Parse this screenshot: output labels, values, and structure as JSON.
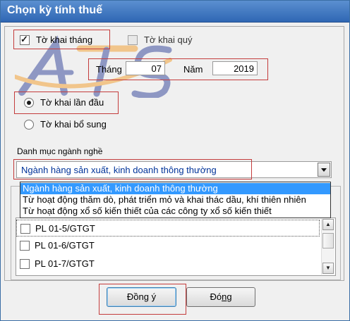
{
  "window": {
    "title": "Chọn kỳ tính thuế"
  },
  "period": {
    "monthly_label": "Tờ khai tháng",
    "monthly_checked": true,
    "quarterly_label": "Tờ khai quý",
    "quarterly_checked": false,
    "month_label": "Tháng",
    "month_value": "07",
    "year_label": "Năm",
    "year_value": "2019"
  },
  "declaration": {
    "first_label": "Tờ khai lần đầu",
    "first_selected": true,
    "supplement_label": "Tờ khai bổ sung",
    "supplement_selected": false
  },
  "industry": {
    "label": "Danh mục ngành nghề",
    "selected": "Ngành hàng sản xuất, kinh doanh thông thường",
    "options": [
      "Ngành hàng sản xuất, kinh doanh thông thường",
      "Từ hoạt động thăm dò, phát triển mỏ và khai thác dầu, khí thiên nhiên",
      "Từ hoạt động xổ số kiến thiết của các công ty xổ số kiến thiết"
    ]
  },
  "appendices": [
    {
      "label": "PL 01-5/GTGT",
      "checked": false
    },
    {
      "label": "PL 01-6/GTGT",
      "checked": false
    },
    {
      "label": "PL 01-7/GTGT",
      "checked": false
    }
  ],
  "buttons": {
    "ok_label": "Đồng ý",
    "ok_mnemonic": "g",
    "close_label": "Đóng",
    "close_mnemonic": "n"
  },
  "watermark": {
    "text": "ATS",
    "colors": [
      "#3f4fa0",
      "#f2a33a"
    ]
  },
  "colors": {
    "highlight": "#c43c3c",
    "selection": "#3399ff",
    "title_bar": "#2f67b4"
  }
}
